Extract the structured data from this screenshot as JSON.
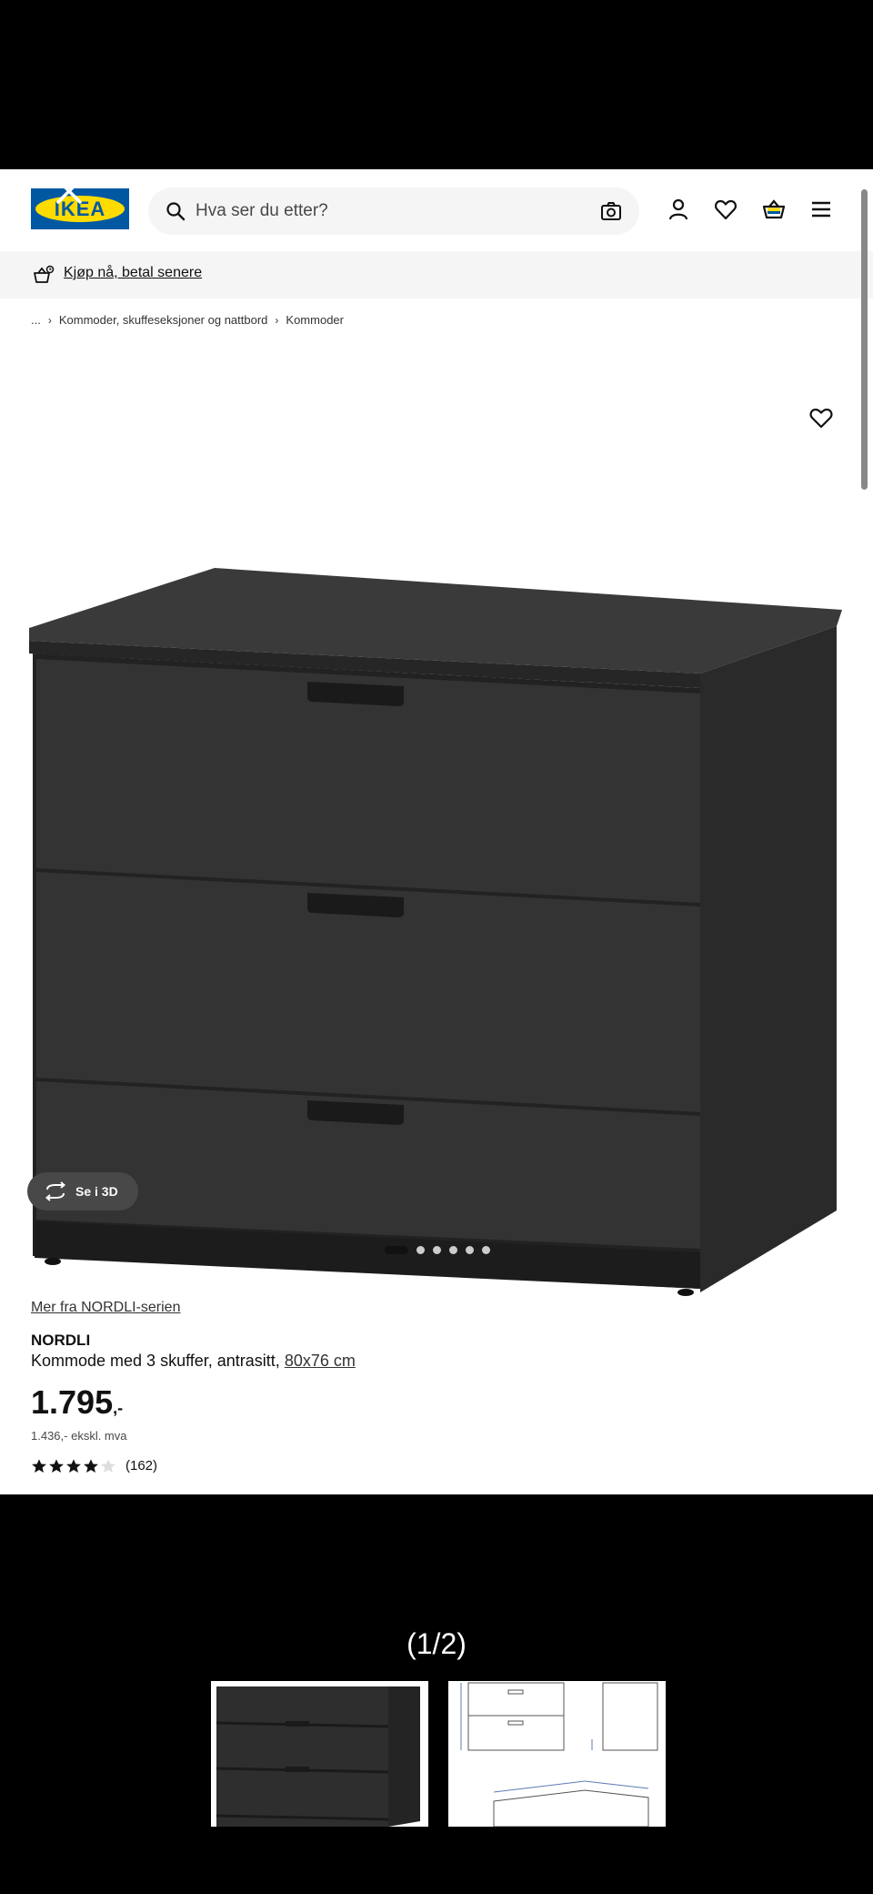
{
  "search": {
    "placeholder": "Hva ser du etter?"
  },
  "logo": {
    "text": "IKEA"
  },
  "promo": {
    "label": "Kjøp nå, betal senere"
  },
  "breadcrumb": [
    "...",
    "Kommoder, skuffeseksjoner og nattbord",
    "Kommoder"
  ],
  "gallery": {
    "view3d_label": "Se i 3D",
    "dot_count": 6,
    "active_dot": 0
  },
  "product": {
    "series_link": "Mer fra NORDLI-serien",
    "name": "NORDLI",
    "description": "Kommode med 3 skuffer, antrasitt, ",
    "size": "80x76 cm",
    "price": "1.795",
    "price_suffix": ",-",
    "price_ex_vat": "1.436,- ekskl. mva",
    "rating_stars": 4,
    "rating_max": 5,
    "review_count": "(162)"
  },
  "viewer": {
    "counter": "(1/2)"
  },
  "colors": {
    "ikea_blue": "#0058a3",
    "ikea_yellow": "#ffdb00",
    "product": "#2f2f2f"
  }
}
